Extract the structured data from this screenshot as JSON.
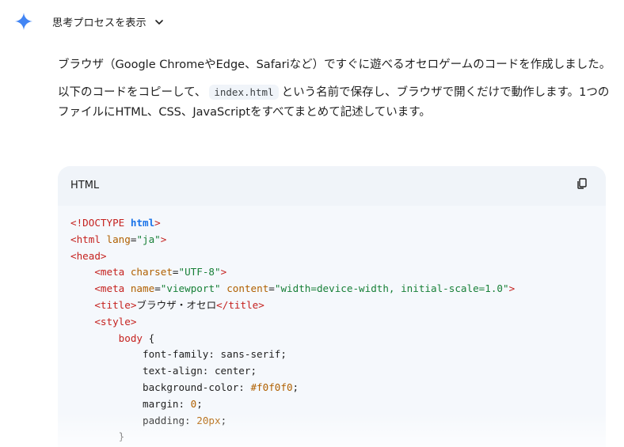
{
  "thought": {
    "label": "思考プロセスを表示",
    "spark_icon": "gemini-spark-icon",
    "chevron_icon": "chevron-down-icon",
    "spark_color": "#4285f4"
  },
  "response": {
    "para1": "ブラウザ（Google ChromeやEdge、Safariなど）ですぐに遊べるオセロゲームのコードを作成しました。",
    "para2_before": "以下のコードをコピーして、",
    "para2_code": "index.html",
    "para2_after": "という名前で保存し、ブラウザで開くだけで動作します。1つのファイルにHTML、CSS、JavaScriptをすべてまとめて記述しています。"
  },
  "code_block": {
    "language": "HTML",
    "copy_icon": "copy-icon",
    "lines": [
      [
        [
          "tag",
          "<!DOCTYPE "
        ],
        [
          "kw",
          "html"
        ],
        [
          "tag",
          ">"
        ]
      ],
      [
        [
          "tag",
          "<html "
        ],
        [
          "attr",
          "lang"
        ],
        [
          "punct",
          "="
        ],
        [
          "str",
          "\"ja\""
        ],
        [
          "tag",
          ">"
        ]
      ],
      [
        [
          "tag",
          "<head>"
        ]
      ],
      [
        [
          "punct",
          "    "
        ],
        [
          "tag",
          "<meta "
        ],
        [
          "attr",
          "charset"
        ],
        [
          "punct",
          "="
        ],
        [
          "str",
          "\"UTF-8\""
        ],
        [
          "tag",
          ">"
        ]
      ],
      [
        [
          "punct",
          "    "
        ],
        [
          "tag",
          "<meta "
        ],
        [
          "attr",
          "name"
        ],
        [
          "punct",
          "="
        ],
        [
          "str",
          "\"viewport\""
        ],
        [
          "punct",
          " "
        ],
        [
          "attr",
          "content"
        ],
        [
          "punct",
          "="
        ],
        [
          "str",
          "\"width=device-width, initial-scale=1.0\""
        ],
        [
          "tag",
          ">"
        ]
      ],
      [
        [
          "punct",
          "    "
        ],
        [
          "tag",
          "<title>"
        ],
        [
          "punct",
          "ブラウザ・オセロ"
        ],
        [
          "tag",
          "</title>"
        ]
      ],
      [
        [
          "punct",
          "    "
        ],
        [
          "tag",
          "<style>"
        ]
      ],
      [
        [
          "punct",
          "        "
        ],
        [
          "tag",
          "body "
        ],
        [
          "punct",
          "{"
        ]
      ],
      [
        [
          "punct",
          "            font-family: sans-serif;"
        ]
      ],
      [
        [
          "punct",
          "            text-align: center;"
        ]
      ],
      [
        [
          "punct",
          "            background-color: "
        ],
        [
          "num",
          "#f0f0f0"
        ],
        [
          "punct",
          ";"
        ]
      ],
      [
        [
          "punct",
          "            margin: "
        ],
        [
          "num",
          "0"
        ],
        [
          "punct",
          ";"
        ]
      ],
      [
        [
          "punct",
          "            padding: "
        ],
        [
          "num",
          "20px"
        ],
        [
          "punct",
          ";"
        ]
      ],
      [
        [
          "punct",
          "        }"
        ]
      ]
    ]
  }
}
